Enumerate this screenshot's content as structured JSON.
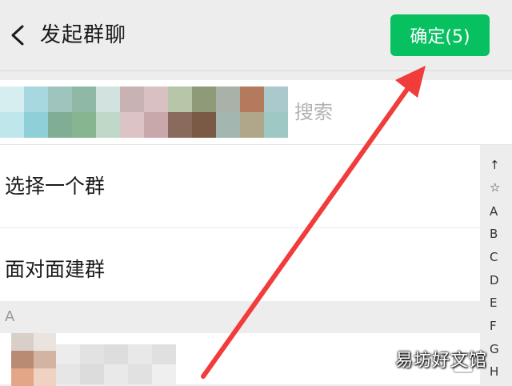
{
  "header": {
    "title": "发起群聊",
    "confirm_label": "确定(5)",
    "confirm_color": "#07c160"
  },
  "search": {
    "placeholder": "搜索",
    "value": ""
  },
  "menu": {
    "items": [
      {
        "label": "选择一个群"
      },
      {
        "label": "面对面建群"
      }
    ]
  },
  "contacts": {
    "section_letter": "A"
  },
  "index_bar": {
    "letters": [
      "↑",
      "☆",
      "A",
      "B",
      "C",
      "D",
      "E",
      "F",
      "G",
      "H"
    ]
  },
  "watermark": {
    "text": "易坊好文馆"
  },
  "annotation": {
    "arrow_color": "#f23b3b"
  }
}
